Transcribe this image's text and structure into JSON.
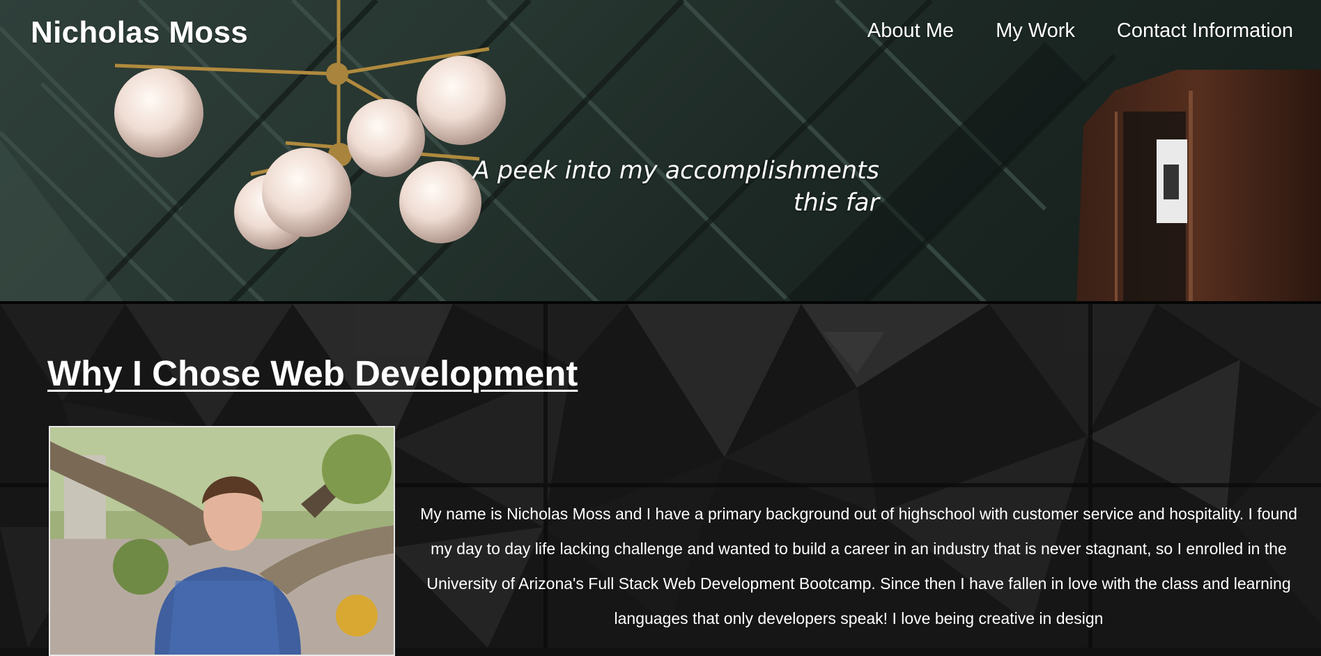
{
  "header": {
    "site_title": "Nicholas Moss",
    "nav": [
      "About Me",
      "My Work",
      "Contact Information"
    ],
    "tagline_line1": "A peek into my accomplishments",
    "tagline_line2": "this far"
  },
  "about": {
    "heading": "Why I Chose Web Development",
    "photo_icon": "profile-photo",
    "bio": "My name is Nicholas Moss and I have a primary background out of highschool with customer service and hospitality. I found my day to day life lacking challenge and wanted to build a career in an industry that is never stagnant, so I enrolled in the University of Arizona's Full Stack Web Development Bootcamp. Since then I have fallen in love with the class and learning languages that only developers speak! I love being creative in design"
  },
  "colors": {
    "hero_wall": "#26352f",
    "main_bg": "#161616",
    "text": "#ffffff"
  }
}
